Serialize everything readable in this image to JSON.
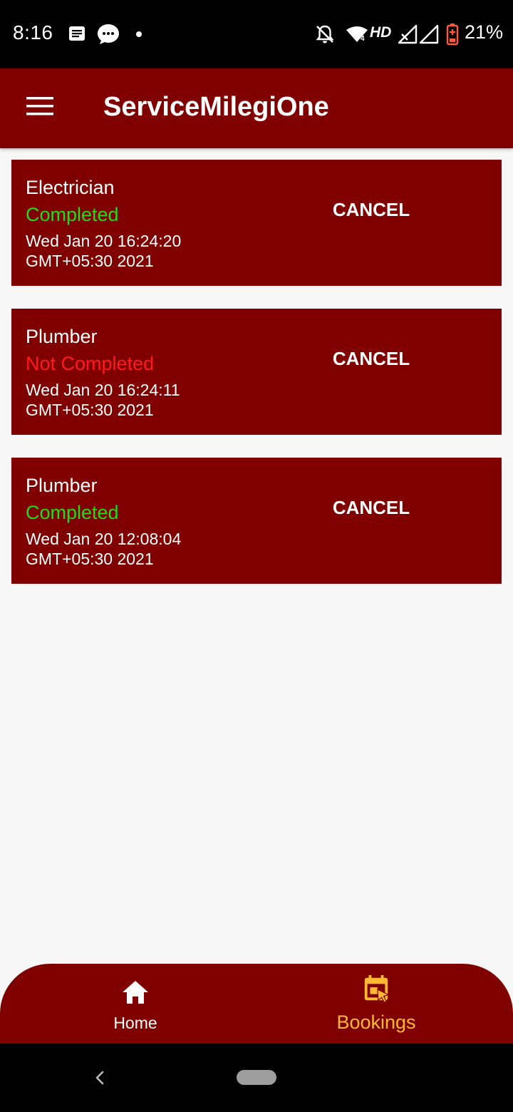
{
  "status_bar": {
    "time": "8:16",
    "network": "HD",
    "battery": "21%",
    "icons": [
      "notes-icon",
      "chat-icon",
      "dot-icon",
      "bell-off-icon",
      "wifi-icon",
      "signal-icon",
      "signal-icon",
      "battery-icon"
    ]
  },
  "app_bar": {
    "title": "ServiceMilegiOne",
    "menu_icon": "hamburger-menu-icon"
  },
  "bookings": [
    {
      "service": "Electrician",
      "status": "Completed",
      "status_color": "#22dd11",
      "date_line1": "Wed Jan 20 16:24:20",
      "date_line2": "GMT+05:30 2021",
      "action": "CANCEL"
    },
    {
      "service": "Plumber",
      "status": "Not Completed",
      "status_color": "#ff1a1a",
      "date_line1": "Wed Jan 20 16:24:11",
      "date_line2": "GMT+05:30 2021",
      "action": "CANCEL"
    },
    {
      "service": "Plumber",
      "status": "Completed",
      "status_color": "#22dd11",
      "date_line1": "Wed Jan 20 12:08:04",
      "date_line2": "GMT+05:30 2021",
      "action": "CANCEL"
    }
  ],
  "bottom_nav": {
    "items": [
      {
        "label": "Home",
        "icon": "home-icon",
        "active": false
      },
      {
        "label": "Bookings",
        "icon": "calendar-icon",
        "active": true
      }
    ]
  },
  "colors": {
    "primary": "#800000",
    "active_tab": "#ffb933",
    "completed": "#22dd11",
    "not_completed": "#ff1a1a",
    "background": "#f7f7f7"
  }
}
